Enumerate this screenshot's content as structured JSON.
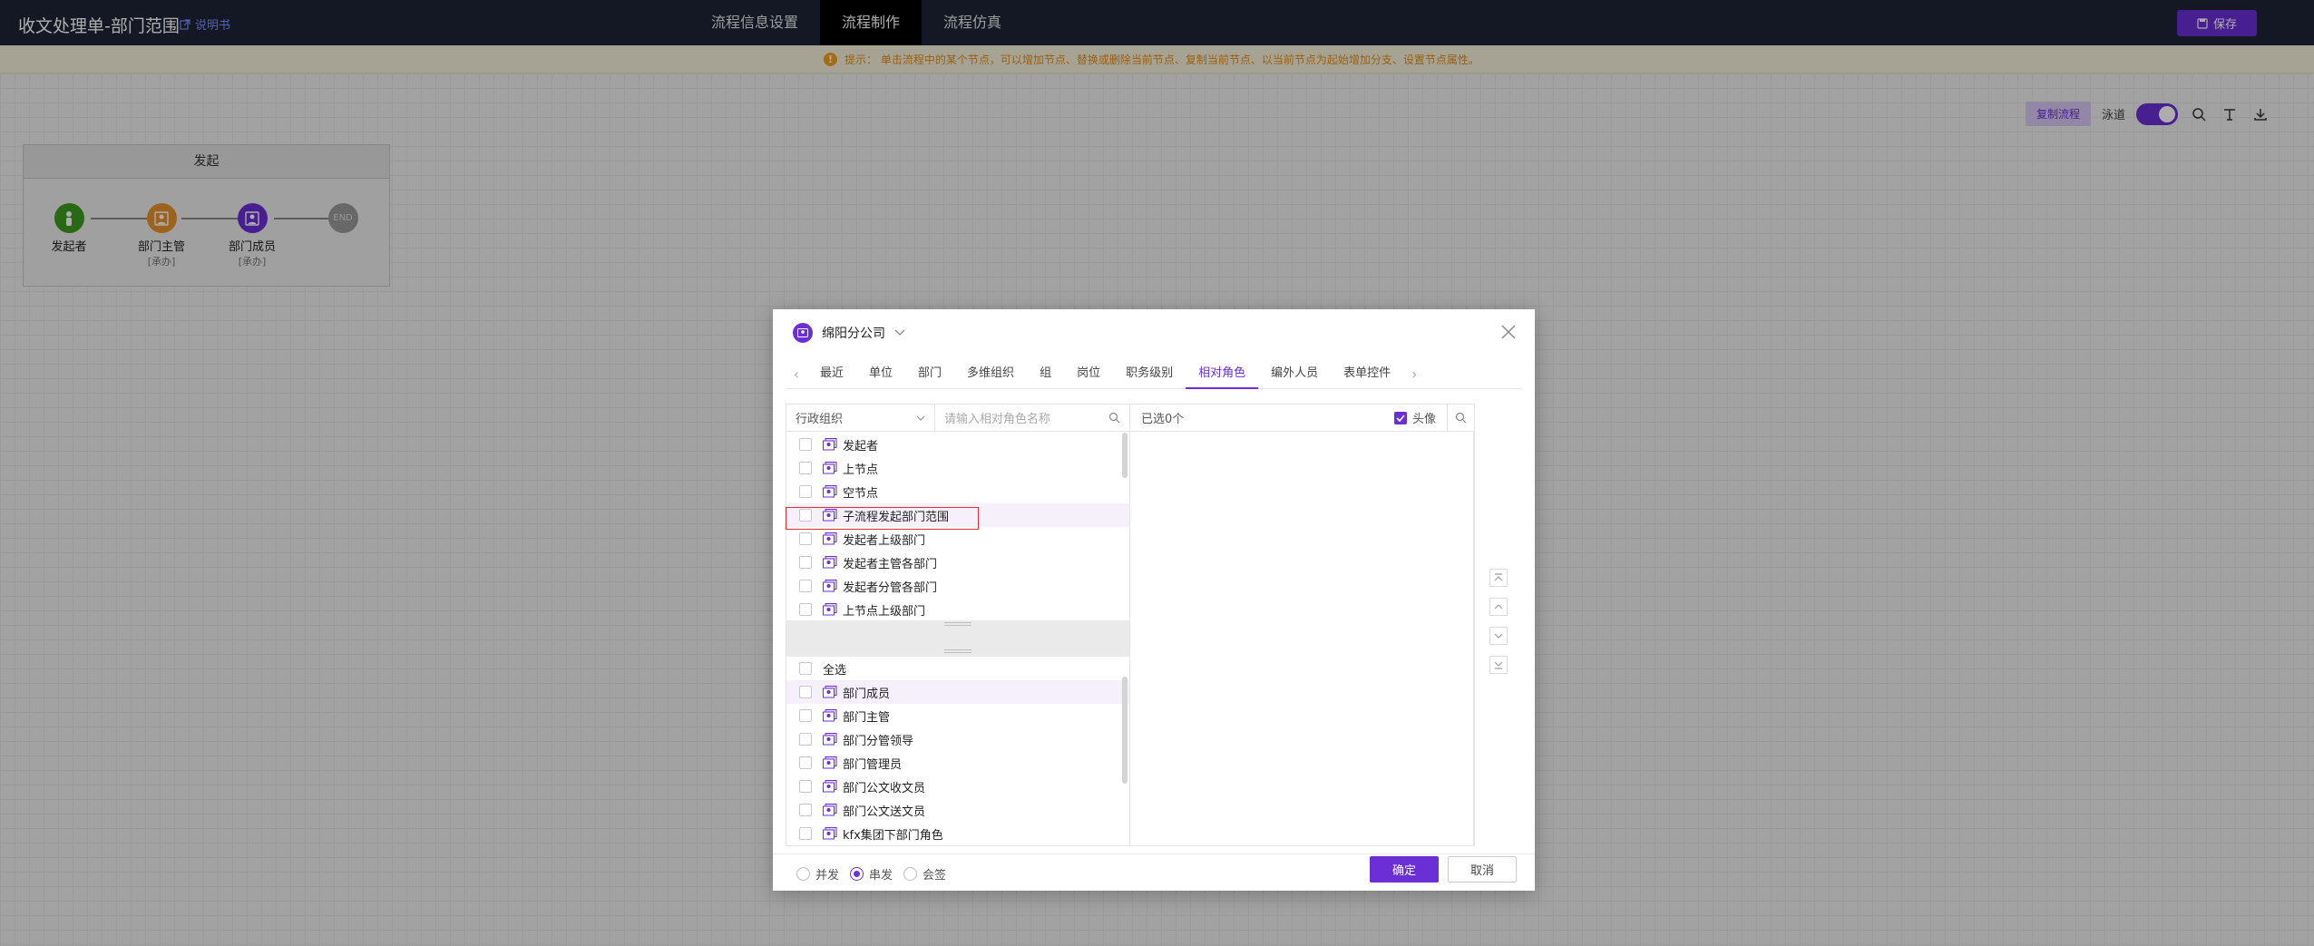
{
  "header": {
    "title": "收文处理单-部门范围",
    "instruction": "说明书",
    "nav_tabs": [
      {
        "label": "流程信息设置"
      },
      {
        "label": "流程制作"
      },
      {
        "label": "流程仿真"
      }
    ],
    "active_tab": "流程制作",
    "save_label": "保存"
  },
  "hint": {
    "text": "提示： 单击流程中的某个节点，可以增加节点、替换或删除当前节点、复制当前节点、以当前节点为起始增加分支、设置节点属性。"
  },
  "canvas_tools": {
    "copy_flow_label": "复制流程",
    "lane_label": "泳道",
    "lane_toggle_on": true
  },
  "lane": {
    "title": "发起",
    "nodes": [
      {
        "label": "发起者",
        "sub": "",
        "color": "#3d9a1f"
      },
      {
        "label": "部门主管",
        "sub": "[承办]",
        "color": "#e8922b"
      },
      {
        "label": "部门成员",
        "sub": "[承办]",
        "color": "#6b2fd6"
      },
      {
        "label": "END",
        "sub": "",
        "color": "#9a9a9a"
      }
    ]
  },
  "dialog": {
    "org_name": "绵阳分公司",
    "category_tabs": [
      "最近",
      "单位",
      "部门",
      "多维组织",
      "组",
      "岗位",
      "职务级别",
      "相对角色",
      "编外人员",
      "表单控件"
    ],
    "active_category": "相对角色",
    "filter": {
      "select_value": "行政组织",
      "search_placeholder": "请输入相对角色名称"
    },
    "upper_list": [
      {
        "label": "发起者"
      },
      {
        "label": "上节点"
      },
      {
        "label": "空节点"
      },
      {
        "label": "子流程发起部门范围"
      },
      {
        "label": "发起者上级部门"
      },
      {
        "label": "发起者主管各部门"
      },
      {
        "label": "发起者分管各部门"
      },
      {
        "label": "上节点上级部门"
      }
    ],
    "highlighted_upper_index": 3,
    "select_all_label": "全选",
    "lower_list": [
      {
        "label": "部门成员"
      },
      {
        "label": "部门主管"
      },
      {
        "label": "部门分管领导"
      },
      {
        "label": "部门管理员"
      },
      {
        "label": "部门公文收文员"
      },
      {
        "label": "部门公文送文员"
      },
      {
        "label": "kfx集团下部门角色"
      }
    ],
    "highlighted_lower_index": 0,
    "selected_summary": "已选0个",
    "avatar_label": "头像",
    "avatar_checked": true,
    "modes": [
      {
        "label": "并发",
        "checked": false
      },
      {
        "label": "串发",
        "checked": true
      },
      {
        "label": "会签",
        "checked": false
      }
    ],
    "ok_label": "确定",
    "cancel_label": "取消"
  },
  "colors": {
    "accent": "#6b2fd6",
    "topbar": "#1e2436",
    "hint_text": "#e08e1a"
  }
}
